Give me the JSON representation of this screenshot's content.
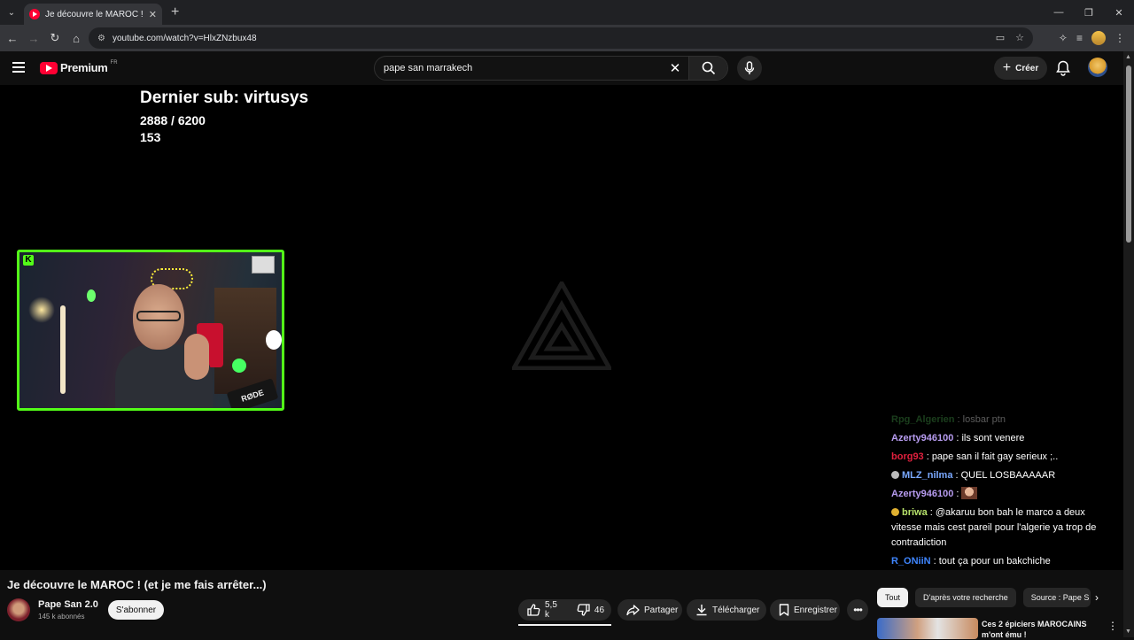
{
  "browser": {
    "tab_title": "Je découvre le MAROC ! (et je me fais arrêter...)",
    "url": "youtube.com/watch?v=HlxZNzbux48"
  },
  "header": {
    "logo_text": "Premium",
    "region": "FR",
    "search_value": "pape san marrakech",
    "create_label": "Créer"
  },
  "stream_overlay": {
    "last_sub": "Dernier sub: virtusys",
    "sub_goal": "2888 / 6200",
    "counter": "153",
    "mic_brand": "RØDE"
  },
  "chat": [
    {
      "user": "Rpg_Algerien",
      "text": "losbar ptn",
      "color": "#4caf50",
      "faded": true
    },
    {
      "user": "Azerty946100",
      "text": "ils sont venere",
      "color": "#b79cf0"
    },
    {
      "user": "borg93",
      "text": "pape san il fait gay serieux ;..",
      "color": "#e2203e"
    },
    {
      "user": "MLZ_nilma",
      "text": "QUEL LOSBAAAAAR",
      "color": "#7aa9ff",
      "badge": "#bbbbbb"
    },
    {
      "user": "Azerty946100",
      "text": "",
      "color": "#b79cf0",
      "emote": true
    },
    {
      "user": "briwa",
      "text": "@akaruu bon bah le marco a deux vitesse mais cest pareil pour l'algerie ya trop de contradiction",
      "color": "#b7e26b",
      "badge": "#e0b030"
    },
    {
      "user": "R_ONiiN",
      "text": "tout ça pour un bakchiche",
      "color": "#3f86ff"
    }
  ],
  "video": {
    "title": "Je découvre le MAROC ! (et je me fais arrêter...)",
    "channel": "Pape San 2.0",
    "subscribers": "145 k abonnés",
    "subscribe_label": "S'abonner",
    "likes": "5,5 k",
    "dislikes": "46",
    "share_label": "Partager",
    "download_label": "Télécharger",
    "save_label": "Enregistrer"
  },
  "chips": [
    "Tout",
    "D'après votre recherche",
    "Source : Pape S"
  ],
  "recommendation": {
    "title": "Ces 2 épiciers MAROCAINS m'ont ému !"
  },
  "colors": {
    "kick_green": "#53fc18",
    "yt_red": "#ff0033"
  }
}
